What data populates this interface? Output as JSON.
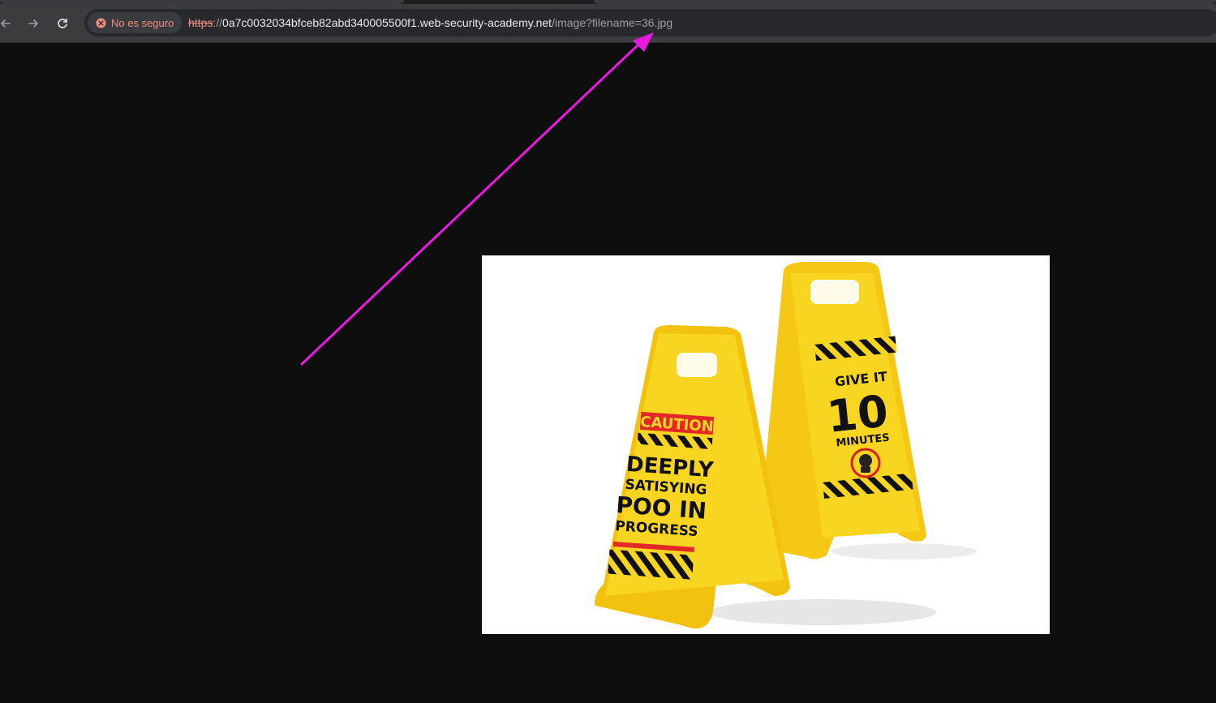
{
  "browser": {
    "security_chip": {
      "label": "No es seguro",
      "icon": "warning-icon",
      "color": "#f28b82"
    },
    "url": {
      "scheme": "https",
      "separator": "://",
      "host": "0a7c0032034bfceb82abd340005500f1.web-security-academy.net",
      "path": "/image?filename=36.jpg"
    },
    "nav": {
      "back_icon": "back-arrow-icon",
      "forward_icon": "forward-arrow-icon",
      "reload_icon": "reload-icon"
    }
  },
  "image": {
    "front_sign": {
      "header": "CAUTION",
      "line1": "DEEPLY",
      "line2": "SATISYING",
      "line3": "POO IN",
      "line4": "PROGRESS"
    },
    "back_sign": {
      "line1": "GIVE IT",
      "line2": "10",
      "line3": "MINUTES"
    },
    "sign_color": "#f7d21b"
  },
  "annotation": {
    "color": "#e81ae0",
    "type": "arrow"
  }
}
